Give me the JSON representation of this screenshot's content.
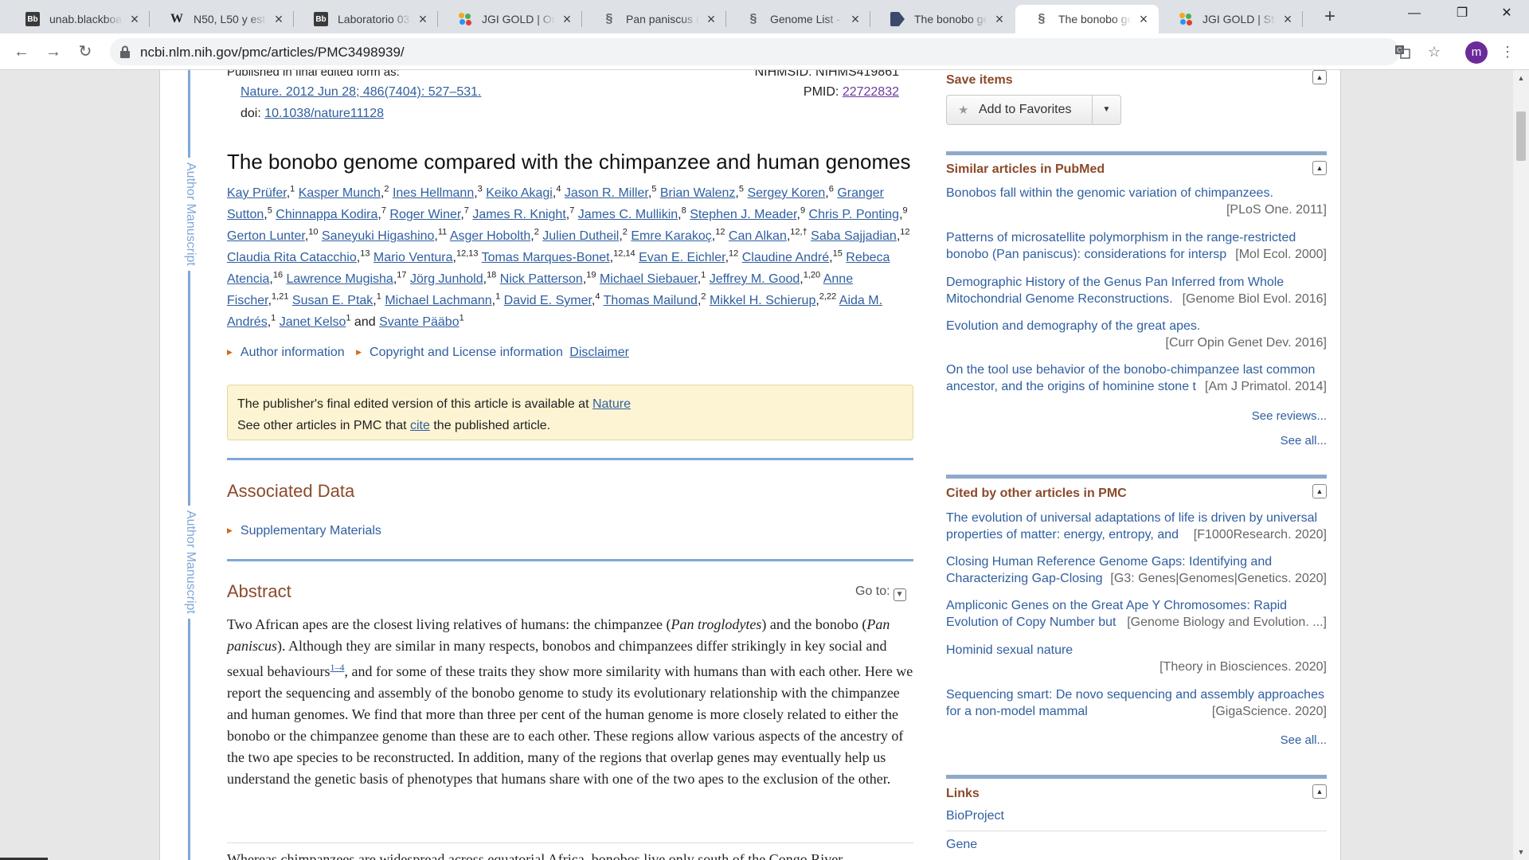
{
  "browser": {
    "tabs": [
      {
        "title": "unab.blackboard",
        "favicon": "blackboard-icon"
      },
      {
        "title": "N50, L50 y esta",
        "favicon": "wikipedia-icon"
      },
      {
        "title": "Laboratorio 03",
        "favicon": "blackboard-icon"
      },
      {
        "title": "JGI GOLD | Org",
        "favicon": "jgi-icon"
      },
      {
        "title": "Pan paniscus (b",
        "favicon": "ncbi-icon"
      },
      {
        "title": "Genome List - (",
        "favicon": "ncbi-icon"
      },
      {
        "title": "The bonobo ge",
        "favicon": "nature-icon"
      },
      {
        "title": "The bonobo ge",
        "favicon": "ncbi-icon"
      },
      {
        "title": "JGI GOLD | Stat",
        "favicon": "jgi-icon"
      }
    ],
    "active_tab": 7,
    "url": "ncbi.nlm.nih.gov/pmc/articles/PMC3498939/",
    "profile_initial": "m"
  },
  "article": {
    "published_note": "Published in final edited form as:",
    "nihmsid": "NIHMSID: NIHMS419861",
    "citation": "Nature. 2012 Jun 28; 486(7404): 527–531.",
    "pmid_label": "PMID:",
    "pmid": "22722832",
    "doi_label": "doi:",
    "doi": "10.1038/nature11128",
    "title": "The bonobo genome compared with the chimpanzee and human genomes",
    "authors": [
      {
        "name": "Kay Prüfer",
        "sup": "1"
      },
      {
        "name": "Kasper Munch",
        "sup": "2"
      },
      {
        "name": "Ines Hellmann",
        "sup": "3"
      },
      {
        "name": "Keiko Akagi",
        "sup": "4"
      },
      {
        "name": "Jason R. Miller",
        "sup": "5"
      },
      {
        "name": "Brian Walenz",
        "sup": "5"
      },
      {
        "name": "Sergey Koren",
        "sup": "6"
      },
      {
        "name": "Granger Sutton",
        "sup": "5"
      },
      {
        "name": "Chinnappa Kodira",
        "sup": "7"
      },
      {
        "name": "Roger Winer",
        "sup": "7"
      },
      {
        "name": "James R. Knight",
        "sup": "7"
      },
      {
        "name": "James C. Mullikin",
        "sup": "8"
      },
      {
        "name": "Stephen J. Meader",
        "sup": "9"
      },
      {
        "name": "Chris P. Ponting",
        "sup": "9"
      },
      {
        "name": "Gerton Lunter",
        "sup": "10"
      },
      {
        "name": "Saneyuki Higashino",
        "sup": "11"
      },
      {
        "name": "Asger Hobolth",
        "sup": "2"
      },
      {
        "name": "Julien Dutheil",
        "sup": "2"
      },
      {
        "name": "Emre Karakoç",
        "sup": "12"
      },
      {
        "name": "Can Alkan",
        "sup": "12,†"
      },
      {
        "name": "Saba Sajjadian",
        "sup": "12"
      },
      {
        "name": "Claudia Rita Catacchio",
        "sup": "13"
      },
      {
        "name": "Mario Ventura",
        "sup": "12,13"
      },
      {
        "name": "Tomas Marques-Bonet",
        "sup": "12,14"
      },
      {
        "name": "Evan E. Eichler",
        "sup": "12"
      },
      {
        "name": "Claudine André",
        "sup": "15"
      },
      {
        "name": "Rebeca Atencia",
        "sup": "16"
      },
      {
        "name": "Lawrence Mugisha",
        "sup": "17"
      },
      {
        "name": "Jörg Junhold",
        "sup": "18"
      },
      {
        "name": "Nick Patterson",
        "sup": "19"
      },
      {
        "name": "Michael Siebauer",
        "sup": "1"
      },
      {
        "name": "Jeffrey M. Good",
        "sup": "1,20"
      },
      {
        "name": "Anne Fischer",
        "sup": "1,21"
      },
      {
        "name": "Susan E. Ptak",
        "sup": "1"
      },
      {
        "name": "Michael Lachmann",
        "sup": "1"
      },
      {
        "name": "David E. Symer",
        "sup": "4"
      },
      {
        "name": "Thomas Mailund",
        "sup": "2"
      },
      {
        "name": "Mikkel H. Schierup",
        "sup": "2,22"
      },
      {
        "name": "Aida M. Andrés",
        "sup": "1"
      },
      {
        "name": "Janet Kelso",
        "sup": "1"
      },
      {
        "name": "Svante Pääbo",
        "sup": "1"
      }
    ],
    "and_word": "and",
    "author_info": "Author information",
    "copyright": "Copyright and License information",
    "disclaimer": "Disclaimer",
    "notice_line1": "The publisher's final edited version of this article is available at",
    "notice_link1": "Nature",
    "notice_line2_a": "See other articles in PMC that",
    "notice_link2": "cite",
    "notice_line2_b": "the published article.",
    "margin_label": "Author Manuscript",
    "associated_data": "Associated Data",
    "supplementary": "Supplementary Materials",
    "abstract_heading": "Abstract",
    "goto_label": "Go to:",
    "abstract_p1": "Two African apes are the closest living relatives of humans: the chimpanzee (",
    "abstract_i1": "Pan troglodytes",
    "abstract_p2": ") and the bonobo (",
    "abstract_i2": "Pan paniscus",
    "abstract_p3": "). Although they are similar in many respects, bonobos and chimpanzees differ strikingly in key social and sexual behaviours",
    "abstract_ref": "1–4",
    "abstract_p4": ", and for some of these traits they show more similarity with humans than with each other. Here we report the sequencing and assembly of the bonobo genome to study its evolutionary relationship with the chimpanzee and human genomes. We find that more than three per cent of the human genome is more closely related to either the bonobo or the chimpanzee genome than these are to each other. These regions allow various aspects of the ancestry of the two ape species to be reconstructed. In addition, many of the regions that overlap genes may eventually help us understand the genetic basis of phenotypes that humans share with one of the two apes to the exclusion of the other.",
    "body_start": "Whereas chimpanzees are widespread across equatorial Africa, bonobos live only south of the Congo River"
  },
  "sidebar": {
    "save_heading": "Save items",
    "add_favorites": "Add to Favorites",
    "similar_heading": "Similar articles in PubMed",
    "similar": [
      {
        "title": "Bonobos fall within the genomic variation of chimpanzees.",
        "journal": "[PLoS One. 2011]"
      },
      {
        "title": "Patterns of microsatellite polymorphism in the range-restricted bonobo (Pan paniscus): considerations for intersp",
        "journal": "[Mol Ecol. 2000]"
      },
      {
        "title": "Demographic History of the Genus Pan Inferred from Whole Mitochondrial Genome Reconstructions.",
        "journal": "[Genome Biol Evol. 2016]"
      },
      {
        "title": "Evolution and demography of the great apes.",
        "journal": "[Curr Opin Genet Dev. 2016]"
      },
      {
        "title": "On the tool use behavior of the bonobo-chimpanzee last common ancestor, and the origins of hominine stone t",
        "journal": "[Am J Primatol. 2014]"
      }
    ],
    "see_reviews": "See reviews...",
    "see_all_1": "See all...",
    "cited_heading": "Cited by other articles in PMC",
    "cited": [
      {
        "title": "The evolution of universal adaptations of life is driven by universal properties of matter: energy, entropy, and",
        "journal": "[F1000Research. 2020]"
      },
      {
        "title": "Closing Human Reference Genome Gaps: Identifying and Characterizing Gap-Closing",
        "journal": "[G3: Genes|Genomes|Genetics. 2020]"
      },
      {
        "title": "Ampliconic Genes on the Great Ape Y Chromosomes: Rapid Evolution of Copy Number but",
        "journal": "[Genome Biology and Evolution. ...]"
      },
      {
        "title": "Hominid sexual nature",
        "journal": "[Theory in Biosciences. 2020]"
      },
      {
        "title": "Sequencing smart: De novo sequencing and assembly approaches for a non-model mammal",
        "journal": "[GigaScience. 2020]"
      }
    ],
    "see_all_2": "See all...",
    "links_heading": "Links",
    "links": [
      "BioProject",
      "Gene"
    ]
  },
  "colors": {
    "accent_link": "#2f5fa0",
    "section_heading": "#8b4a2a",
    "rule_blue": "#7ea8d8",
    "notice_bg": "#fdf4d3"
  }
}
